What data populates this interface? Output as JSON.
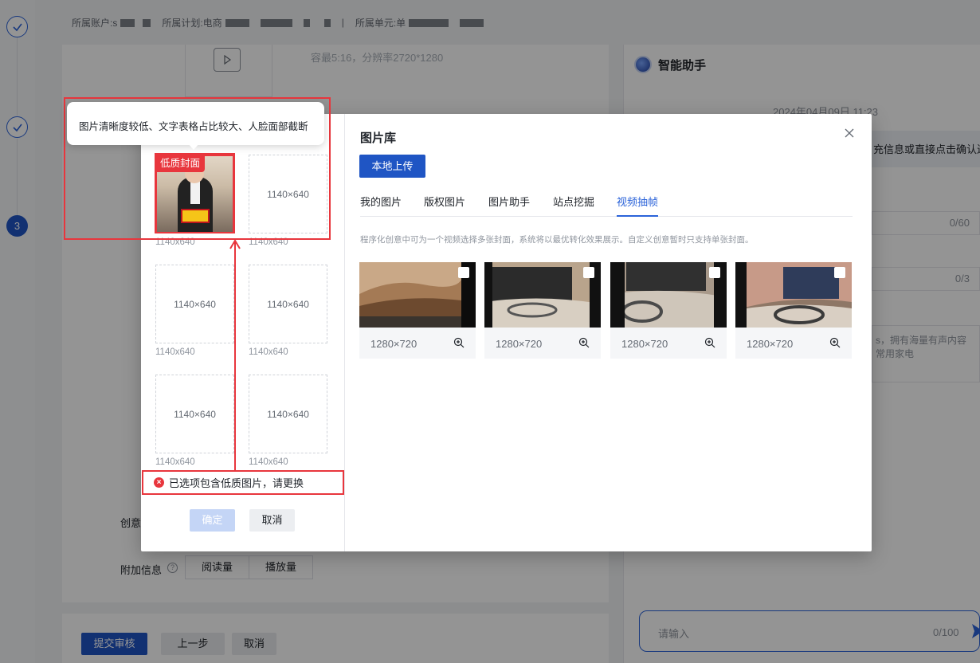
{
  "background": {
    "top_bar": {
      "account_label": "所属账户:",
      "account_value": "s",
      "plan_label": "所属计划:",
      "plan_value": "电商",
      "divider": "|",
      "unit_label": "所属单元:",
      "unit_value": "单"
    },
    "steps": {
      "active_step": "3"
    },
    "video_info": "容最5:16，分辨率2720*1280",
    "creative_label": "创意",
    "extra_info_label": "附加信息",
    "help_icon": "?",
    "tags": [
      "阅读量",
      "播放量"
    ],
    "footer": {
      "submit": "提交审核",
      "prev": "上一步",
      "cancel": "取消"
    }
  },
  "assistant": {
    "title": "智能助手",
    "date": "2024年04月09日 11:23",
    "bubble_text": "充信息或直接点击确认进",
    "field_counts": [
      "0/60",
      "0/3"
    ],
    "textarea_text": "s，拥有海量有声内容 常用家电",
    "input_placeholder": "请输入",
    "input_count": "0/100"
  },
  "modal": {
    "title": "图片库",
    "upload_button": "本地上传",
    "tabs": [
      {
        "label": "我的图片",
        "active": false
      },
      {
        "label": "版权图片",
        "active": false
      },
      {
        "label": "图片助手",
        "active": false
      },
      {
        "label": "站点挖掘",
        "active": false
      },
      {
        "label": "视频抽帧",
        "active": true
      }
    ],
    "hint": "程序化创意中可为一个视频选择多张封面，系统将以最优转化效果展示。自定义创意暂时只支持单张封面。",
    "frames": [
      {
        "resolution": "1280×720"
      },
      {
        "resolution": "1280×720"
      },
      {
        "resolution": "1280×720"
      },
      {
        "resolution": "1280×720"
      }
    ],
    "selected": {
      "low_quality_tag": "低质封面",
      "slots": [
        {
          "label": "",
          "caption": "1140x640"
        },
        {
          "label": "1140×640",
          "caption": "1140x640"
        },
        {
          "label": "1140×640",
          "caption": "1140x640"
        },
        {
          "label": "1140×640",
          "caption": "1140x640"
        },
        {
          "label": "1140×640",
          "caption": "1140x640"
        },
        {
          "label": "1140×640",
          "caption": "1140x640"
        }
      ]
    },
    "error_message": "已选项包含低质图片，请更换",
    "error_icon": "×",
    "confirm_button": "确定",
    "cancel_button": "取消"
  },
  "annotation": {
    "tooltip": "图片清晰度较低、文字表格占比较大、人脸面部截断"
  },
  "colors": {
    "primary": "#1f55c4",
    "accent": "#2b63d9",
    "error": "#e8363d"
  }
}
